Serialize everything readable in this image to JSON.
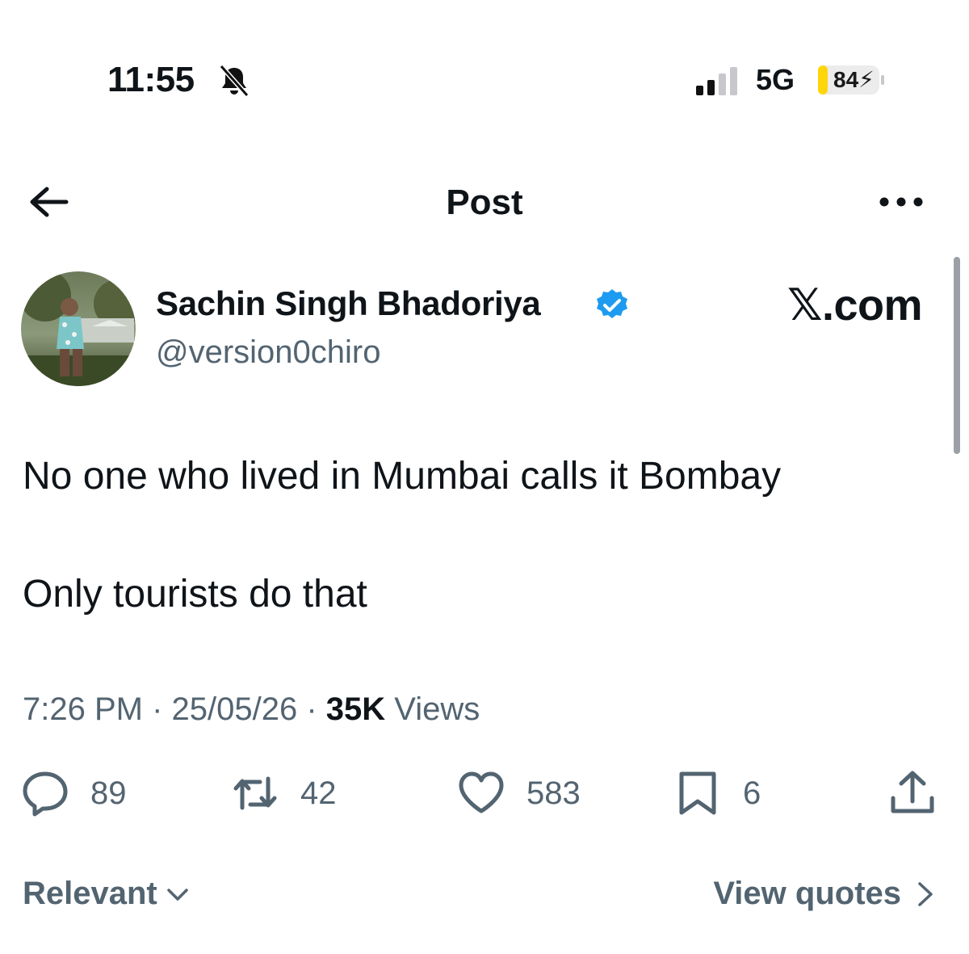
{
  "status_bar": {
    "time": "11:55",
    "network": "5G",
    "battery": "84",
    "icons": [
      "bell-slash-icon",
      "cellular-signal-icon",
      "battery-charging-icon"
    ]
  },
  "header": {
    "title": "Post",
    "icons": [
      "arrow-left-icon",
      "more-dots-icon"
    ]
  },
  "author": {
    "display_name": "Sachin Singh Bhadoriya",
    "handle": "@version0chiro",
    "verified": true,
    "source": "𝕏.com"
  },
  "post": {
    "line1": "No one who lived in Mumbai calls it Bombay",
    "line2": "Only tourists do that"
  },
  "meta": {
    "time": "7:26 PM",
    "separator": " · ",
    "date": "25/05/26",
    "views_count": "35K",
    "views_label": " Views"
  },
  "actions": {
    "replies": "89",
    "reposts": "42",
    "likes": "583",
    "bookmarks": "6",
    "icons": [
      "reply-icon",
      "repost-icon",
      "like-icon",
      "bookmark-icon",
      "share-icon"
    ]
  },
  "footer": {
    "sort_label": "Relevant",
    "view_quotes_label": "View quotes"
  },
  "colors": {
    "text": "#0f1419",
    "secondary": "#536471",
    "verified_blue": "#1d9bf0",
    "battery_yellow": "#ffd60a"
  }
}
